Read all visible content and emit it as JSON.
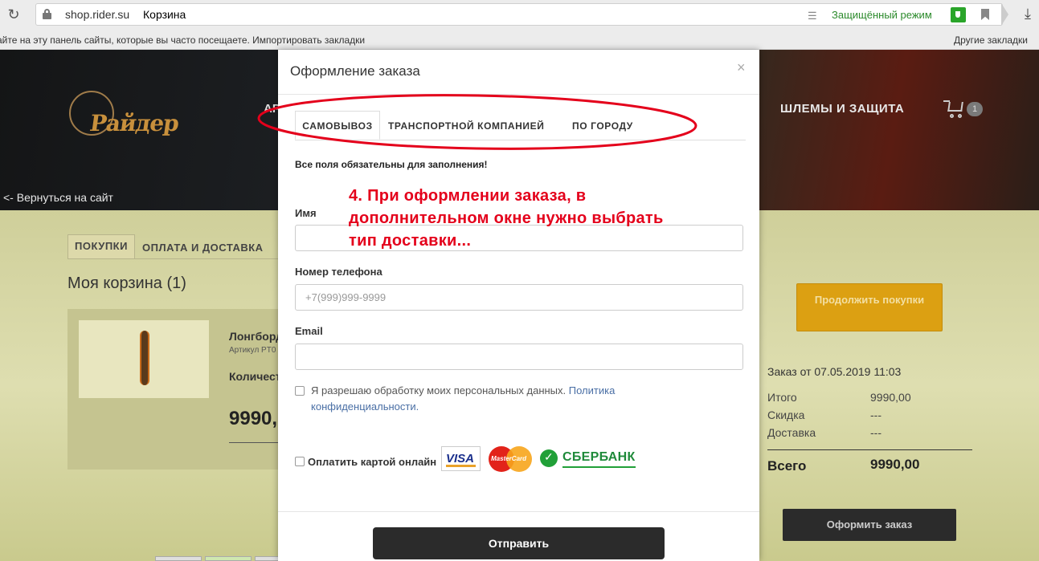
{
  "browser": {
    "domain": "shop.rider.su",
    "page_title": "Корзина",
    "secure_label": "Защищённый режим",
    "bookmarks_hint": "айте на эту панель сайты, которые вы часто посещаете. Импортировать закладки",
    "other_bookmarks": "Другие закладки"
  },
  "site": {
    "logo_text": "Райдер",
    "back_link": "<- Вернуться на сайт",
    "nav_partial": "АР",
    "nav_helmets": "ШЛЕМЫ И ЗАЩИТА",
    "cart_count": "1"
  },
  "cart_page": {
    "tabs": [
      "ПОКУПКИ",
      "ОПЛАТА И ДОСТАВКА"
    ],
    "title": "Моя корзина (1)",
    "product": {
      "name": "Лонгборд",
      "article": "Артикул PT0",
      "quantity_label": "Количест",
      "price": "9990,"
    },
    "continue_button": "Продолжить покупки",
    "order_date": "Заказ от 07.05.2019 11:03",
    "summary": [
      {
        "label": "Итого",
        "value": "9990,00"
      },
      {
        "label": "Скидка",
        "value": "---"
      },
      {
        "label": "Доставка",
        "value": "---"
      }
    ],
    "total_label": "Всего",
    "total_value": "9990,00",
    "order_button": "Оформить заказ"
  },
  "modal": {
    "title": "Оформление заказа",
    "close": "×",
    "delivery_tabs": [
      "САМОВЫВОЗ",
      "ТРАНСПОРТНОЙ КОМПАНИЕЙ",
      "ПО ГОРОДУ"
    ],
    "required_note": "Все поля обязательны для заполнения!",
    "fields": {
      "name_label": "Имя",
      "name_value": "",
      "phone_label": "Номер телефона",
      "phone_placeholder": "+7(999)999-9999",
      "email_label": "Email",
      "email_value": ""
    },
    "consent_text": "Я разрешаю обработку моих персональных данных.",
    "consent_link": "Политика конфиденциальности.",
    "pay_online_label": "Оплатить картой онлайн",
    "payment_logos": {
      "visa": "VISA",
      "mastercard": "MasterCard",
      "sberbank": "СБЕРБАНК"
    },
    "submit_button": "Отправить"
  },
  "annotation": {
    "text": "4. При оформлении заказа, в дополнительном окне нужно выбрать тип доставки...",
    "color": "#e4001b"
  }
}
